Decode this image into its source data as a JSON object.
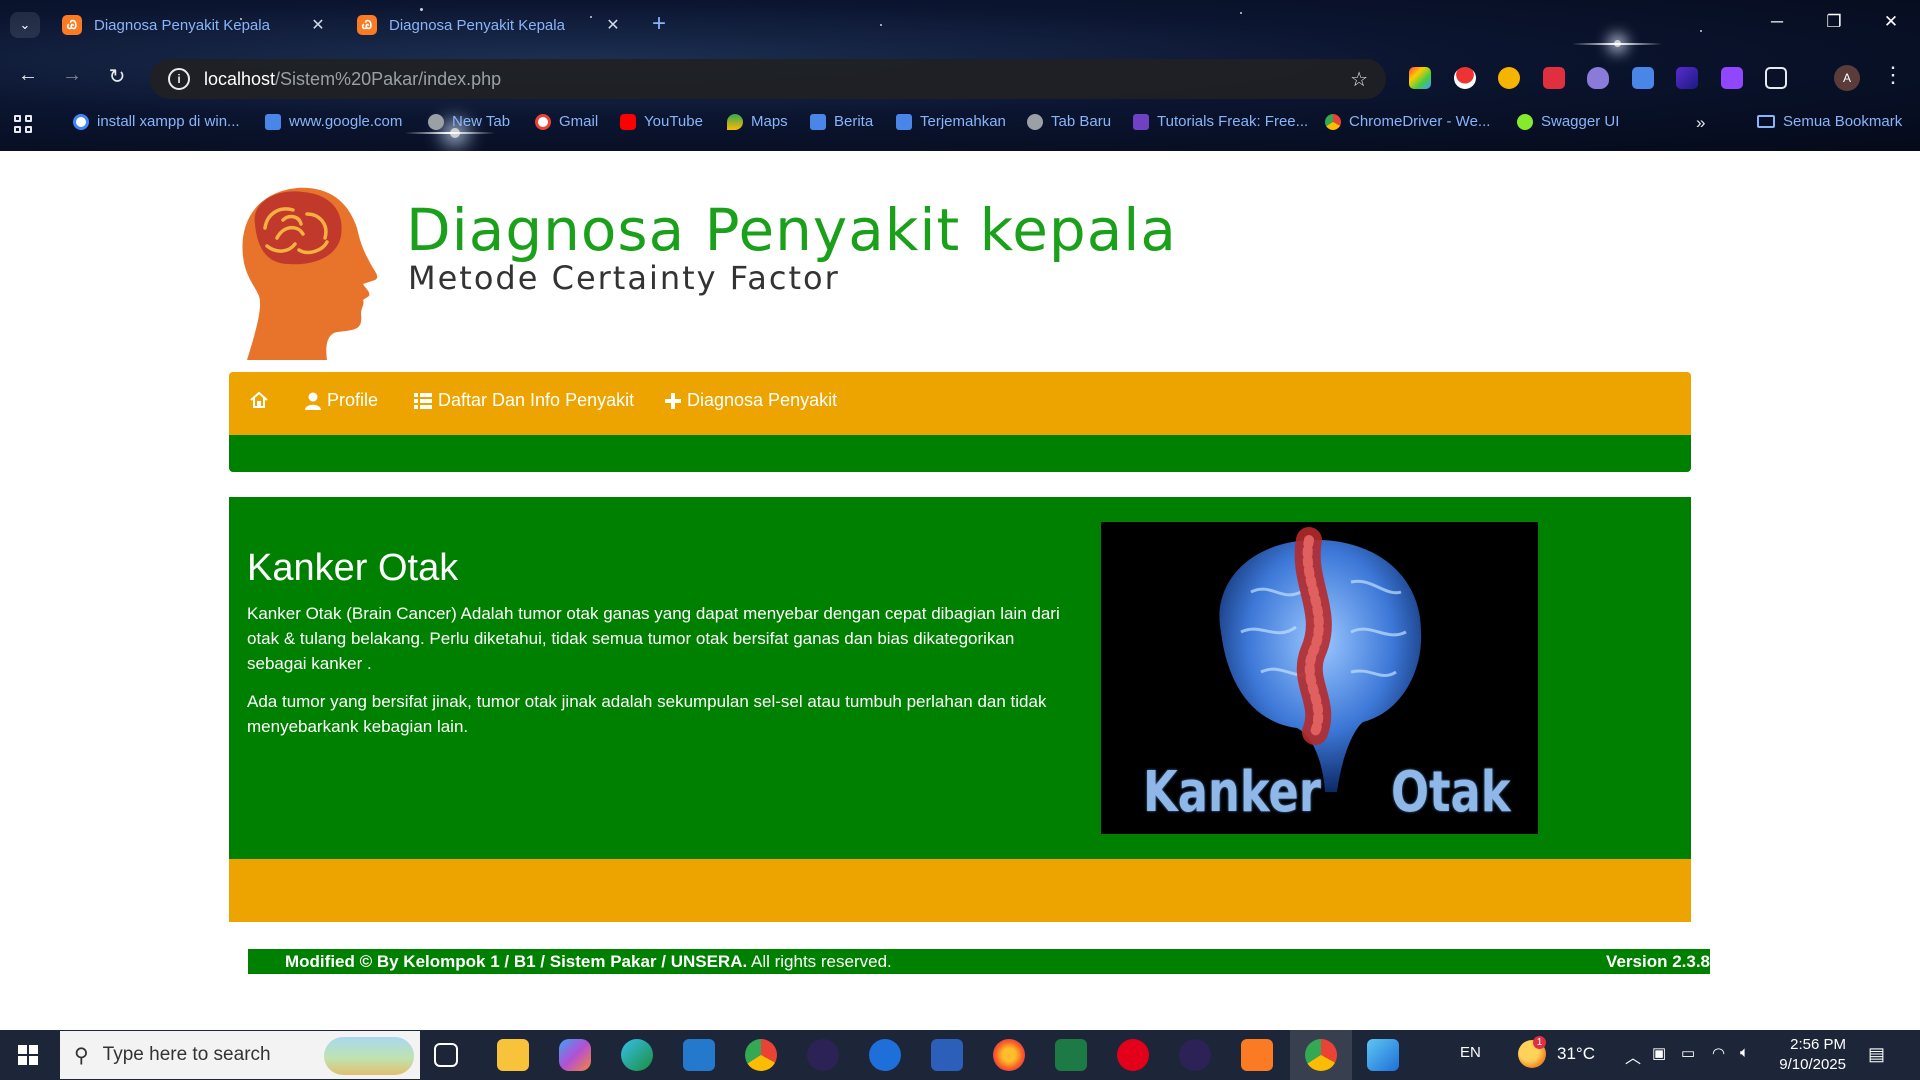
{
  "browser": {
    "tabs": [
      {
        "title": "Diagnosa Penyakit Kepala",
        "favicon": "xampp-icon"
      },
      {
        "title": "Diagnosa Penyakit Kepala",
        "favicon": "xampp-icon"
      }
    ],
    "url_host": "localhost",
    "url_path": "/Sistem%20Pakar/index.php",
    "bookmarks": [
      {
        "label": "install xampp di win...",
        "icon": "google-icon"
      },
      {
        "label": "www.google.com",
        "icon": "search-icon"
      },
      {
        "label": "New Tab",
        "icon": "globe-icon"
      },
      {
        "label": "Gmail",
        "icon": "google-icon"
      },
      {
        "label": "YouTube",
        "icon": "youtube-icon"
      },
      {
        "label": "Maps",
        "icon": "maps-icon"
      },
      {
        "label": "Berita",
        "icon": "news-icon"
      },
      {
        "label": "Terjemahkan",
        "icon": "translate-icon"
      },
      {
        "label": "Tab Baru",
        "icon": "globe-icon"
      },
      {
        "label": "Tutorials Freak: Free...",
        "icon": "tutorials-icon"
      },
      {
        "label": "ChromeDriver - We...",
        "icon": "chrome-icon"
      },
      {
        "label": "Swagger UI",
        "icon": "swagger-icon"
      }
    ],
    "all_bookmarks": "Semua Bookmark",
    "profile_initial": "A"
  },
  "site": {
    "title": "Diagnosa Penyakit kepala",
    "subtitle": "Metode Certainty Factor",
    "menu": [
      {
        "label": "",
        "icon": "home-icon"
      },
      {
        "label": "Profile",
        "icon": "user-icon"
      },
      {
        "label": "Daftar Dan Info Penyakit",
        "icon": "list-icon"
      },
      {
        "label": "Diagnosa Penyakit",
        "icon": "plus-icon"
      }
    ],
    "disease": {
      "name": "Kanker Otak",
      "para1": "Kanker Otak (Brain Cancer) Adalah tumor otak ganas yang dapat menyebar dengan cepat dibagian lain dari otak & tulang belakang. Perlu diketahui, tidak semua tumor otak bersifat ganas dan bias dikategorikan sebagai kanker .",
      "para2": "Ada tumor yang bersifat jinak, tumor otak jinak adalah sekumpulan sel-sel atau tumbuh perlahan dan tidak menyebarkank kebagian lain.",
      "image_caption_left": "Kanker",
      "image_caption_right": "Otak"
    },
    "footer_left": "Modified © By Kelompok 1 / B1 / Sistem Pakar / UNSERA.",
    "footer_left_suffix": " All rights reserved.",
    "footer_right": "Version 2.3.8"
  },
  "taskbar": {
    "search_placeholder": "Type here to search",
    "language": "EN",
    "temperature": "31°C",
    "weather_badge": "1",
    "time": "2:56 PM",
    "date": "9/10/2025"
  },
  "colors": {
    "menu_orange": "#eda400",
    "site_green": "#008000",
    "title_green": "#1aa01a",
    "logo_orange": "#e8732a"
  }
}
